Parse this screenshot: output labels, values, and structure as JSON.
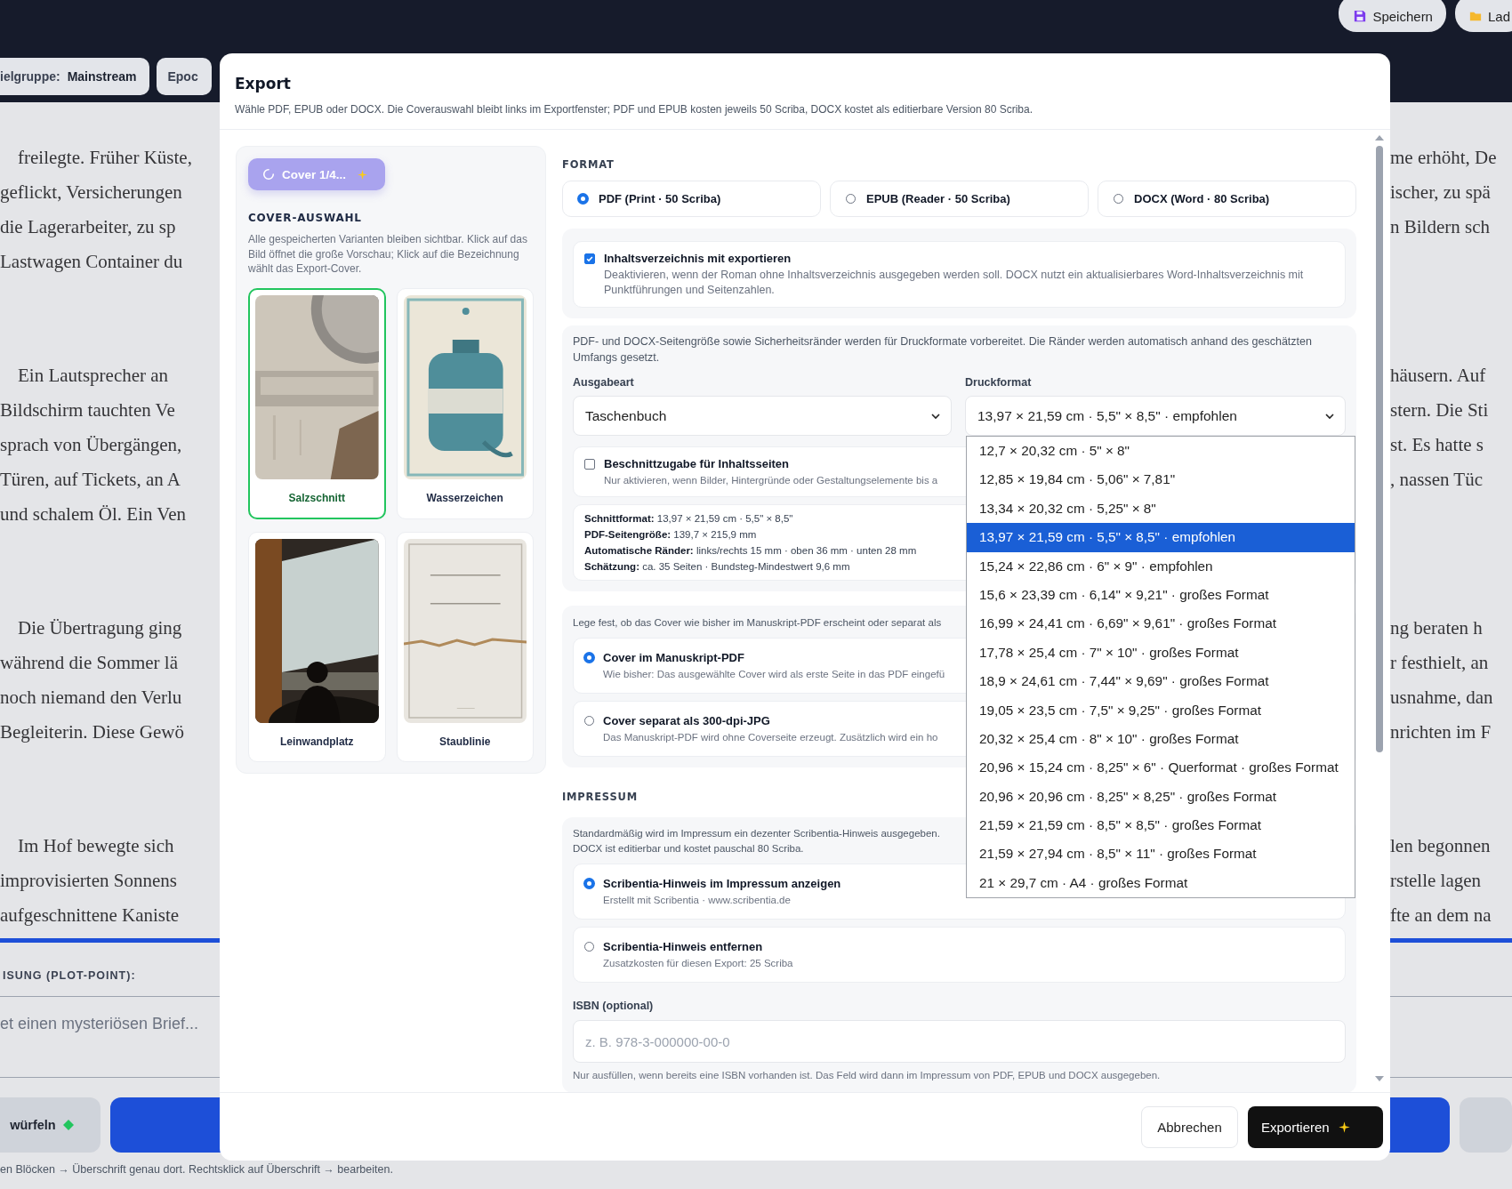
{
  "top_bar": {
    "buttons": [
      {
        "label": "Speichern",
        "kind": "save"
      },
      {
        "label": "Lad",
        "kind": "load"
      }
    ],
    "chips": [
      {
        "label": "ielgruppe:",
        "value": "Mainstream"
      },
      {
        "label": "Epoc"
      }
    ]
  },
  "manuscript": {
    "paragraphs": [
      {
        "left": [
          "freilegte. Früher Küste,",
          "geflickt, Versicherungen",
          "die Lagerarbeiter, zu sp",
          "Lastwagen Container du"
        ],
        "right": [
          "me erhöht, De",
          "ischer, zu spä",
          "n Bildern sch"
        ]
      },
      {
        "left": [
          "Ein Lautsprecher an",
          "Bildschirm tauchten Ve",
          "sprach von Übergängen,",
          "Türen, auf Tickets, an A",
          "und schalem Öl. Ein Ven"
        ],
        "right": [
          "häusern. Auf",
          "stern. Die Sti",
          "st. Es hatte s",
          ", nassen Tüc"
        ]
      },
      {
        "left": [
          "Die Übertragung ging",
          "während die Sommer lä",
          "noch niemand den Verlu",
          "Begleiterin. Diese Gewö"
        ],
        "right": [
          "ng beraten h",
          "r festhielt, an",
          "usnahme, dan",
          "nrichten im F"
        ]
      },
      {
        "left": [
          "Im Hof bewegte sich",
          "improvisierten Sonnens",
          "aufgeschnittene Kaniste"
        ],
        "right": [
          "len begonnen",
          "rstelle lagen",
          "fte an dem na"
        ]
      }
    ]
  },
  "plot_point": {
    "label": "ISUNG (PLOT-POINT):",
    "placeholder": "et einen mysteriösen Brief..."
  },
  "bottom_buttons": [
    {
      "label": "würfeln"
    }
  ],
  "hint": "en Blöcken → Überschrift genau dort. Rechtsklick auf Überschrift → bearbeiten.",
  "dialog": {
    "title": "Export",
    "description": "Wähle PDF, EPUB oder DOCX. Die Coverauswahl bleibt links im Exportfenster; PDF und EPUB kosten jeweils 50 Scriba, DOCX kostet als editierbare Version 80 Scriba.",
    "cover_panel": {
      "button": "Cover 1/4...",
      "heading": "COVER-AUSWAHL",
      "description": "Alle gespeicherten Varianten bleiben sichtbar. Klick auf das Bild öffnet die große Vorschau; Klick auf die Bezeichnung wählt das Export-Cover.",
      "covers": [
        {
          "label": "Salzschnitt",
          "selected": true
        },
        {
          "label": "Wasserzeichen",
          "selected": false
        },
        {
          "label": "Leinwandplatz",
          "selected": false
        },
        {
          "label": "Staublinie",
          "selected": false
        }
      ]
    },
    "format": {
      "heading": "FORMAT",
      "options": [
        {
          "label": "PDF (Print · 50 Scriba)",
          "selected": true
        },
        {
          "label": "EPUB (Reader · 50 Scriba)",
          "selected": false
        },
        {
          "label": "DOCX (Word · 80 Scriba)",
          "selected": false
        }
      ]
    },
    "toc": {
      "label": "Inhaltsverzeichnis mit exportieren",
      "checked": true,
      "description": "Deaktivieren, wenn der Roman ohne Inhaltsverzeichnis ausgegeben werden soll. DOCX nutzt ein aktualisierbares Word-Inhaltsverzeichnis mit Punktführungen und Seitenzahlen."
    },
    "print": {
      "description": "PDF- und DOCX-Seitengröße sowie Sicherheitsränder werden für Druckformate vorbereitet. Die Ränder werden automatisch anhand des geschätzten Umfangs gesetzt.",
      "output_type": {
        "label": "Ausgabeart",
        "value": "Taschenbuch"
      },
      "print_format": {
        "label": "Druckformat",
        "value": "13,97 × 21,59 cm · 5,5\" × 8,5\" · empfohlen",
        "expanded": true,
        "options": [
          {
            "label": "12,7 × 20,32 cm · 5\" × 8\"",
            "selected": false
          },
          {
            "label": "12,85 × 19,84 cm · 5,06\" × 7,81\"",
            "selected": false
          },
          {
            "label": "13,34 × 20,32 cm · 5,25\" × 8\"",
            "selected": false
          },
          {
            "label": "13,97 × 21,59 cm · 5,5\" × 8,5\" · empfohlen",
            "selected": true
          },
          {
            "label": "15,24 × 22,86 cm · 6\" × 9\" · empfohlen",
            "selected": false
          },
          {
            "label": "15,6 × 23,39 cm · 6,14\" × 9,21\" · großes Format",
            "selected": false
          },
          {
            "label": "16,99 × 24,41 cm · 6,69\" × 9,61\" · großes Format",
            "selected": false
          },
          {
            "label": "17,78 × 25,4 cm · 7\" × 10\" · großes Format",
            "selected": false
          },
          {
            "label": "18,9 × 24,61 cm · 7,44\" × 9,69\" · großes Format",
            "selected": false
          },
          {
            "label": "19,05 × 23,5 cm · 7,5\" × 9,25\" · großes Format",
            "selected": false
          },
          {
            "label": "20,32 × 25,4 cm · 8\" × 10\" · großes Format",
            "selected": false
          },
          {
            "label": "20,96 × 15,24 cm · 8,25\" × 6\" · Querformat · großes Format",
            "selected": false
          },
          {
            "label": "20,96 × 20,96 cm · 8,25\" × 8,25\" · großes Format",
            "selected": false
          },
          {
            "label": "21,59 × 21,59 cm · 8,5\" × 8,5\" · großes Format",
            "selected": false
          },
          {
            "label": "21,59 × 27,94 cm · 8,5\" × 11\" · großes Format",
            "selected": false
          },
          {
            "label": "21 × 29,7 cm · A4 · großes Format",
            "selected": false
          }
        ]
      },
      "bleed": {
        "label": "Beschnittzugabe für Inhaltsseiten",
        "checked": false,
        "description": "Nur aktivieren, wenn Bilder, Hintergründe oder Gestaltungselemente bis a"
      },
      "info": [
        "**Schnittformat:** 13,97 × 21,59 cm · 5,5\" × 8,5\"",
        "**PDF-Seitengröße:** 139,7 × 215,9 mm",
        "**Automatische Ränder:** links/rechts 15 mm · oben 36 mm · unten 28 mm",
        "**Schätzung:** ca. 35 Seiten · Bundsteg-Mindestwert 9,6 mm"
      ]
    },
    "cover_mode": {
      "description": "Lege fest, ob das Cover wie bisher im Manuskript-PDF erscheint oder separat als",
      "options": [
        {
          "label": "Cover im Manuskript-PDF",
          "description": "Wie bisher: Das ausgewählte Cover wird als erste Seite in das PDF eingefü",
          "selected": true
        },
        {
          "label": "Cover separat als 300-dpi-JPG",
          "description": "Das Manuskript-PDF wird ohne Coverseite erzeugt. Zusätzlich wird ein ho",
          "selected": false
        }
      ]
    },
    "impressum": {
      "heading": "IMPRESSUM",
      "description": [
        "Standardmäßig wird im Impressum ein dezenter Scribentia-Hinweis ausgegeben.",
        "DOCX ist editierbar und kostet pauschal 80 Scriba."
      ],
      "options": [
        {
          "label": "Scribentia-Hinweis im Impressum anzeigen",
          "description": "Erstellt mit Scribentia · www.scribentia.de",
          "selected": true
        },
        {
          "label": "Scribentia-Hinweis entfernen",
          "description": "Zusatzkosten für diesen Export: 25 Scriba",
          "selected": false
        }
      ],
      "isbn": {
        "label": "ISBN (optional)",
        "placeholder": "z. B. 978-3-000000-00-0",
        "hint": "Nur ausfüllen, wenn bereits eine ISBN vorhanden ist. Das Feld wird dann im Impressum von PDF, EPUB und DOCX ausgegeben."
      }
    },
    "buttons": [
      {
        "label": "Abbrechen",
        "kind": "secondary"
      },
      {
        "label": "Exportieren",
        "kind": "primary"
      }
    ]
  }
}
